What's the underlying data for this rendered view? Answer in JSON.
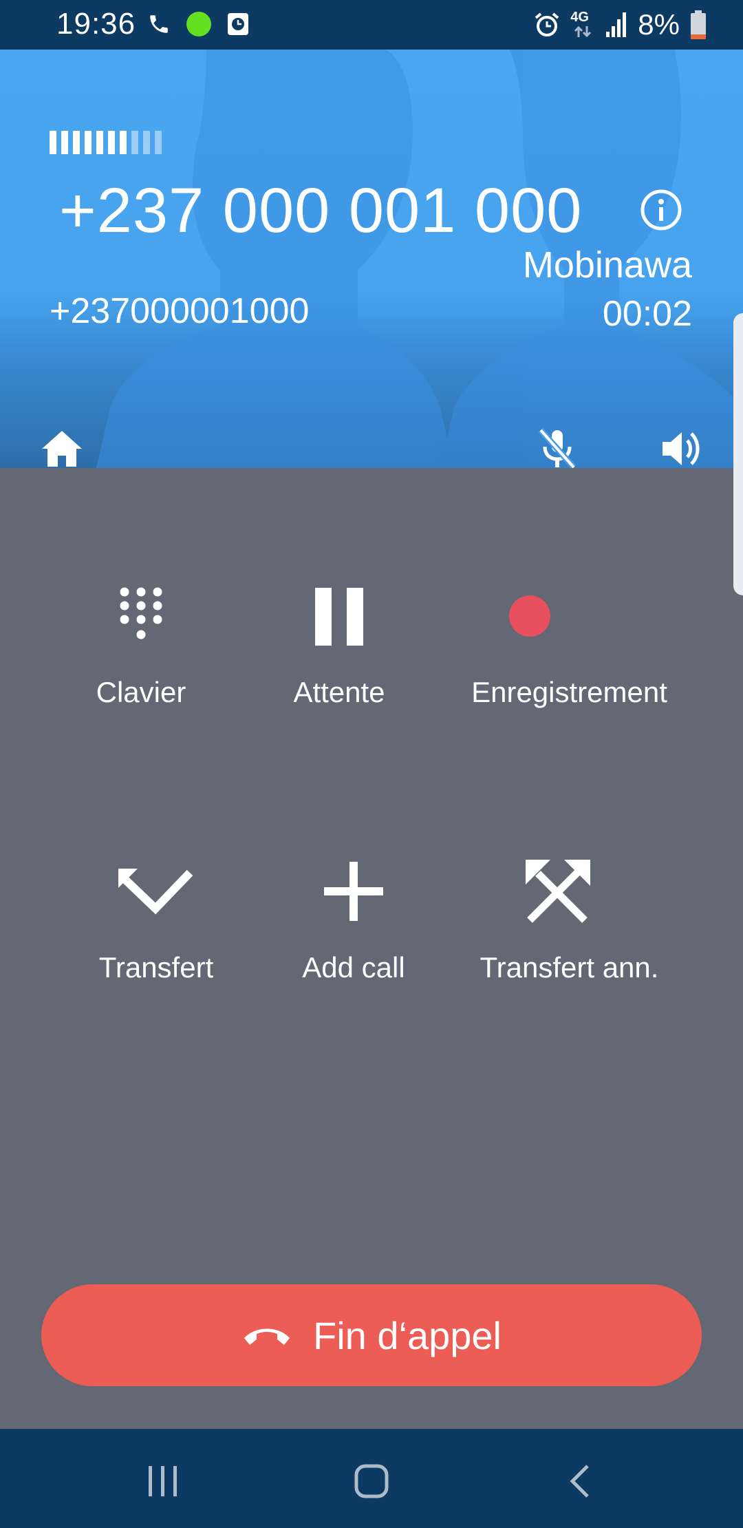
{
  "status_bar": {
    "time": "19:36",
    "network": "4G",
    "battery": "8%",
    "icons": [
      "phone-icon",
      "green-dot-icon",
      "clock-app-icon",
      "alarm-icon",
      "network-arrows-icon",
      "signal-icon",
      "battery-icon"
    ]
  },
  "call": {
    "caller_display": "+237 000 001 000",
    "company": "Mobinawa",
    "number": "+237000001000",
    "duration": "00:02",
    "signal_level": 7,
    "signal_max": 10
  },
  "header_buttons": [
    "home-icon",
    "mute-icon",
    "speaker-icon"
  ],
  "actions": [
    {
      "label": "Clavier",
      "icon": "dialpad-icon"
    },
    {
      "label": "Attente",
      "icon": "pause-icon"
    },
    {
      "label": "Enregistrement",
      "icon": "record-icon"
    },
    {
      "label": "Transfert",
      "icon": "transfer-icon"
    },
    {
      "label": "Add call",
      "icon": "add-call-icon"
    },
    {
      "label": "Transfert ann.",
      "icon": "attended-transfer-icon"
    }
  ],
  "end_call": {
    "label": "Fin d‘appel",
    "icon": "hang-up-icon"
  },
  "colors": {
    "status_bar": "#0c3a63",
    "header_blue": "#4aa6ef",
    "body_gray": "#636874",
    "record_red": "#e8505f",
    "end_call_red": "#ec5d55"
  },
  "nav_bar": [
    "recent-apps-icon",
    "home-nav-icon",
    "back-icon"
  ]
}
